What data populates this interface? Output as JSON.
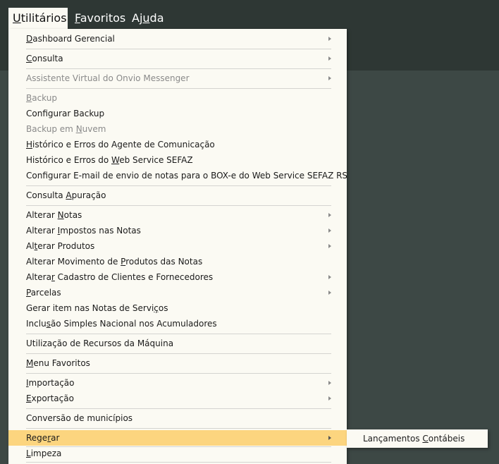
{
  "menubar": [
    {
      "pre": "",
      "u": "U",
      "post": "tilitários"
    },
    {
      "pre": "",
      "u": "F",
      "post": "avoritos"
    },
    {
      "pre": "Aj",
      "u": "u",
      "post": "da"
    }
  ],
  "menu_items": [
    {
      "pre": "",
      "u": "D",
      "post": "ashboard Gerencial"
    },
    {
      "pre": "",
      "u": "C",
      "post": "onsulta"
    },
    {
      "pre": "Assistente Virtual do Onvio Messenger",
      "u": "",
      "post": ""
    },
    {
      "pre": "",
      "u": "B",
      "post": "ackup"
    },
    {
      "pre": "Configurar Backup",
      "u": "",
      "post": ""
    },
    {
      "pre": "Backup em ",
      "u": "N",
      "post": "uvem"
    },
    {
      "pre": "",
      "u": "H",
      "post": "istórico e Erros do Agente de Comunicação"
    },
    {
      "pre": "Histórico e Erros do ",
      "u": "W",
      "post": "eb Service SEFAZ"
    },
    {
      "pre": "Configurar E-mail de envio de notas para o BOX-e do Web Service SEFAZ RS",
      "u": "",
      "post": ""
    },
    {
      "pre": "Consulta ",
      "u": "A",
      "post": "puração"
    },
    {
      "pre": "Alterar ",
      "u": "N",
      "post": "otas"
    },
    {
      "pre": "Alterar ",
      "u": "I",
      "post": "mpostos nas Notas"
    },
    {
      "pre": "Al",
      "u": "t",
      "post": "erar Produtos"
    },
    {
      "pre": "Alterar Movimento de ",
      "u": "P",
      "post": "rodutos das Notas"
    },
    {
      "pre": "Altera",
      "u": "r",
      "post": " Cadastro de Clientes e Fornecedores"
    },
    {
      "pre": "",
      "u": "P",
      "post": "arcelas"
    },
    {
      "pre": "Gerar item nas Notas de Servi",
      "u": "ç",
      "post": "os"
    },
    {
      "pre": "Inclu",
      "u": "s",
      "post": "ão Simples Nacional nos Acumuladores"
    },
    {
      "pre": "Utilização de Recursos da Máquina",
      "u": "",
      "post": ""
    },
    {
      "pre": "",
      "u": "M",
      "post": "enu Favoritos"
    },
    {
      "pre": "",
      "u": "I",
      "post": "mportação"
    },
    {
      "pre": "",
      "u": "E",
      "post": "xportação"
    },
    {
      "pre": "Conversão de municípios",
      "u": "",
      "post": ""
    },
    {
      "pre": "Rege",
      "u": "r",
      "post": "ar"
    },
    {
      "pre": "",
      "u": "L",
      "post": "impeza"
    }
  ],
  "submenu_items": [
    {
      "pre": "Lançamentos ",
      "u": "C",
      "post": "ontábeis"
    }
  ]
}
